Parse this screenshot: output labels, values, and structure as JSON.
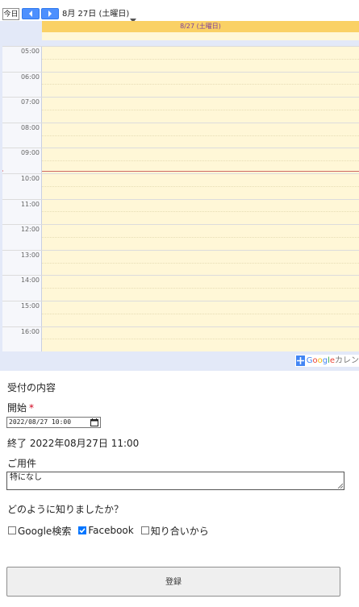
{
  "calendar": {
    "today_label": "今日",
    "date_label": "8月 27日 (土曜日)",
    "day_header": "8/27 (土曜日)",
    "hours": [
      "05:00",
      "06:00",
      "07:00",
      "08:00",
      "09:00",
      "10:00",
      "11:00",
      "12:00",
      "13:00",
      "14:00",
      "15:00",
      "16:00"
    ],
    "badge_text_parts": [
      "G",
      "o",
      "o",
      "g",
      "l",
      "e",
      "カレン"
    ],
    "colors": {
      "header": "#fad165",
      "column": "#fff7d7",
      "nav": "#4d90fe",
      "now_line": "#d06b64"
    }
  },
  "form": {
    "title": "受付の内容",
    "start_label": "開始",
    "required_mark": "*",
    "start_value": "2022/08/27  10:00",
    "end_text": "終了 2022年08月27日 11:00",
    "purpose_label": "ご用件",
    "purpose_value": "特になし",
    "source_question": "どのように知りましたか？",
    "options": [
      {
        "label": "Google検索",
        "checked": false
      },
      {
        "label": "Facebook",
        "checked": true
      },
      {
        "label": "知り合いから",
        "checked": false
      }
    ],
    "submit_label": "登録"
  }
}
